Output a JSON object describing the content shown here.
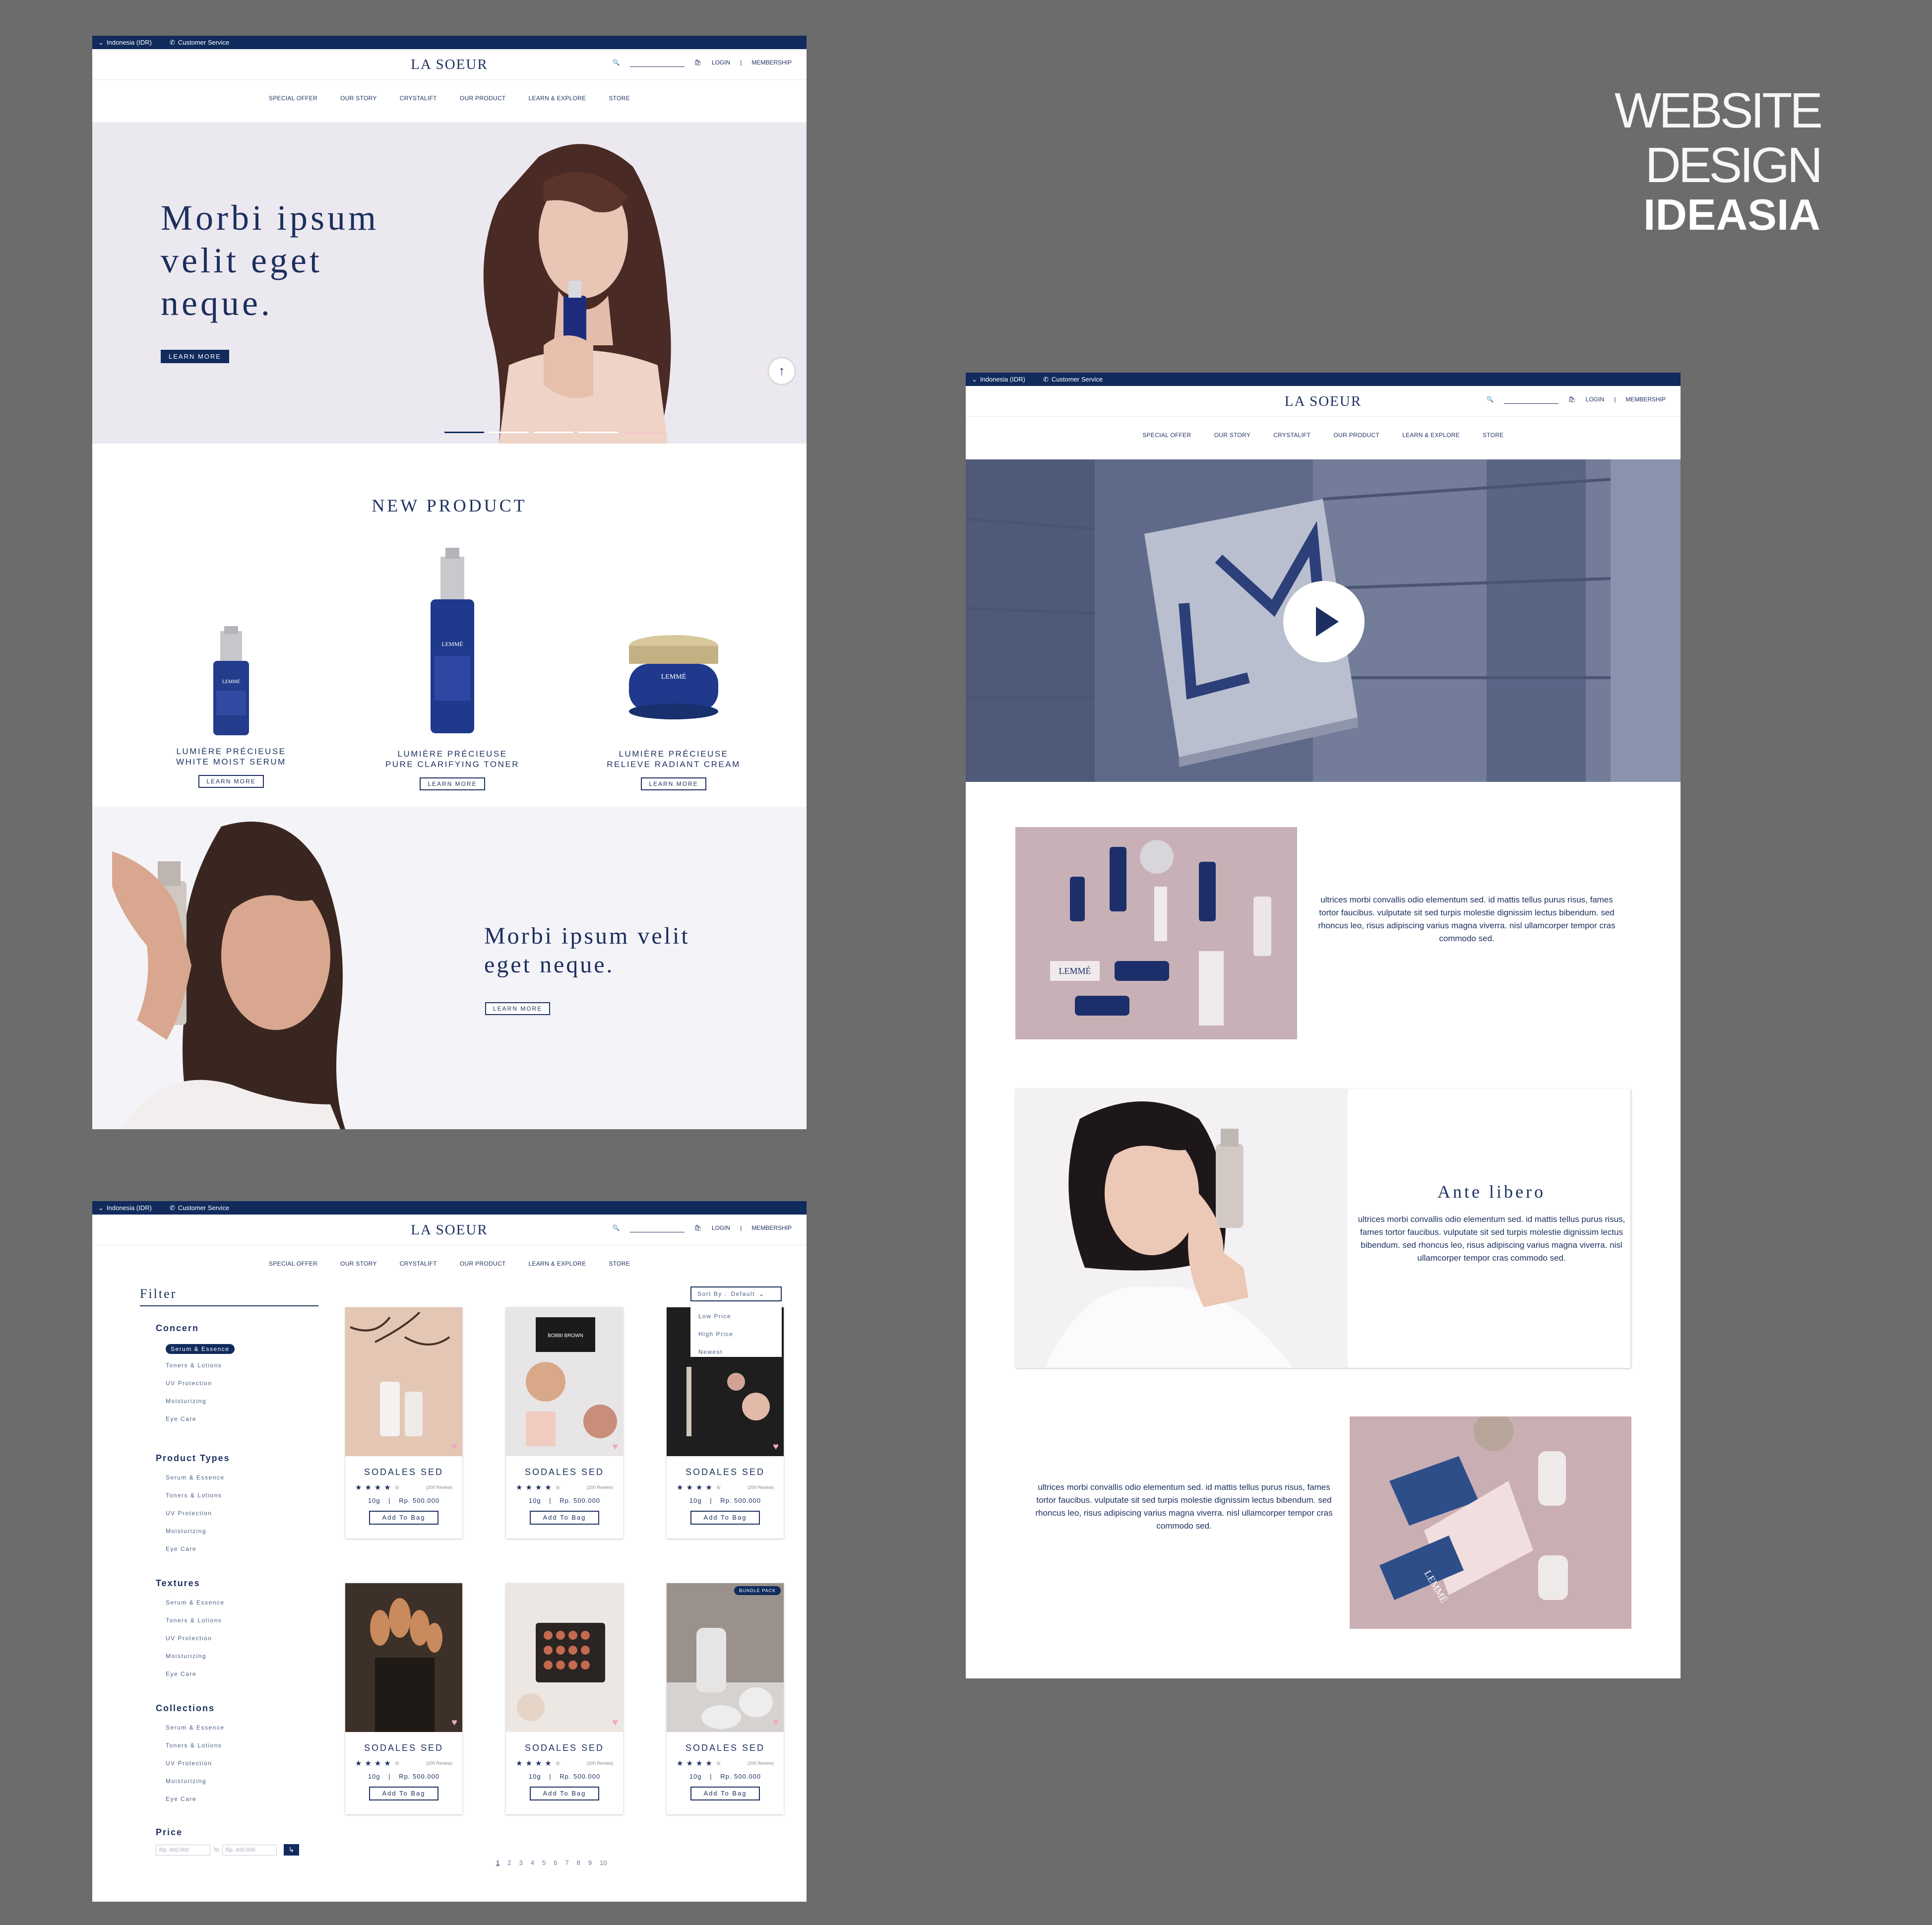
{
  "brand": {
    "title_line1": "WEBSITE DESIGN",
    "title_line2": "IDEASIA"
  },
  "colors": {
    "navy": "#102b5c",
    "hero_bg": "#ece8ef",
    "pink": "#ceb3bb"
  },
  "topbar": {
    "region": "Indonesia (IDR)",
    "service": "Customer Service"
  },
  "header": {
    "logo": "LA SOEUR",
    "login": "LOGIN",
    "divider": "|",
    "membership": "MEMBERSHIP"
  },
  "nav": [
    "SPECIAL OFFER",
    "OUR STORY",
    "CRYSTALIFT",
    "OUR PRODUCT",
    "LEARN & EXPLORE",
    "STORE"
  ],
  "home": {
    "hero": {
      "l1": "Morbi ipsum",
      "l2": "velit eget",
      "l3": "neque.",
      "cta": "LEARN MORE"
    },
    "new_product": {
      "title": "NEW PRODUCT",
      "items": [
        {
          "l1": "LUMIÈRE PRÉCIEUSE",
          "l2": "WHITE MOIST SERUM",
          "cta": "LEARN MORE"
        },
        {
          "l1": "LUMIÈRE PRÉCIEUSE",
          "l2": "PURE CLARIFYING TONER",
          "cta": "LEARN MORE"
        },
        {
          "l1": "LUMIÈRE PRÉCIEUSE",
          "l2": "RELIEVE RADIANT CREAM",
          "cta": "LEARN MORE"
        }
      ]
    },
    "promo": {
      "l1": "Morbi ipsum velit",
      "l2": "eget neque.",
      "cta": "LEARN MORE"
    },
    "bottle_label": "LEMMÉ"
  },
  "story": {
    "text1": "ultrices morbi convallis odio elementum sed. id mattis tellus purus risus, fames tortor faucibus. vulputate sit sed turpis molestie dignissim lectus bibendum. sed rhoncus leo, risus adipiscing varius magna viverra. nisl ullamcorper tempor cras commodo sed.",
    "heading": "Ante libero",
    "text2": "ultrices morbi convallis odio elementum sed. id mattis tellus purus risus, fames tortor faucibus. vulputate sit sed turpis molestie dignissim lectus bibendum. sed rhoncus leo, risus adipiscing varius magna viverra. nisl ullamcorper tempor cras commodo sed.",
    "text3": "ultrices morbi convallis odio elementum sed. id mattis tellus purus risus, fames tortor faucibus. vulputate sit sed turpis molestie dignissim lectus bibendum. sed rhoncus leo, risus adipiscing varius magna viverra. nisl ullamcorper tempor cras commodo sed.",
    "flatlay_label": "LEMMÉ",
    "box_label": "LEMMÉ"
  },
  "shop": {
    "filter_title": "Filter",
    "groups": [
      {
        "title": "Concern",
        "items": [
          "Serum & Essence",
          "Toners & Lotions",
          "UV Protection",
          "Moisturizing",
          "Eye Care"
        ],
        "selected": 0
      },
      {
        "title": "Product Types",
        "items": [
          "Serum & Essence",
          "Toners & Lotions",
          "UV Protection",
          "Moisturizing",
          "Eye Care"
        ]
      },
      {
        "title": "Textures",
        "items": [
          "Serum & Essence",
          "Toners & Lotions",
          "UV Protection",
          "Moisturizing",
          "Eye Care"
        ]
      },
      {
        "title": "Collections",
        "items": [
          "Serum & Essence",
          "Toners & Lotions",
          "UV Protection",
          "Moisturizing",
          "Eye Care"
        ]
      }
    ],
    "price": {
      "title": "Price",
      "min": "Rp. 400.000",
      "to": "To",
      "max": "Rp. 400.000",
      "go": "↳"
    },
    "sort": {
      "label": "Sort By :",
      "value": "Default",
      "options": [
        "Low Price",
        "High Price",
        "Newest"
      ]
    },
    "products": [
      {
        "name": "SODALES SED",
        "rating": 4,
        "reviews": "(200 Review)",
        "size": "10g",
        "sep": "|",
        "price": "Rp. 500.000",
        "cta": "Add To Bag"
      },
      {
        "name": "SODALES SED",
        "rating": 4,
        "reviews": "(200 Review)",
        "size": "10g",
        "sep": "|",
        "price": "Rp. 500.000",
        "cta": "Add To Bag"
      },
      {
        "name": "SODALES SED",
        "rating": 4,
        "reviews": "(200 Review)",
        "size": "10g",
        "sep": "|",
        "price": "Rp. 500.000",
        "cta": "Add To Bag"
      },
      {
        "name": "SODALES SED",
        "rating": 4,
        "reviews": "(200 Review)",
        "size": "10g",
        "sep": "|",
        "price": "Rp. 500.000",
        "cta": "Add To Bag"
      },
      {
        "name": "SODALES SED",
        "rating": 4,
        "reviews": "(200 Review)",
        "size": "10g",
        "sep": "|",
        "price": "Rp. 500.000",
        "cta": "Add To Bag"
      },
      {
        "name": "SODALES SED",
        "rating": 4,
        "reviews": "(200 Review)",
        "size": "10g",
        "sep": "|",
        "price": "Rp. 500.000",
        "cta": "Add To Bag",
        "badge": "BUNDLE PACK"
      }
    ],
    "compact_label": "BOBBI BROWN",
    "pages": [
      "1",
      "2",
      "3",
      "4",
      "5",
      "6",
      "7",
      "8",
      "9",
      "10"
    ]
  }
}
